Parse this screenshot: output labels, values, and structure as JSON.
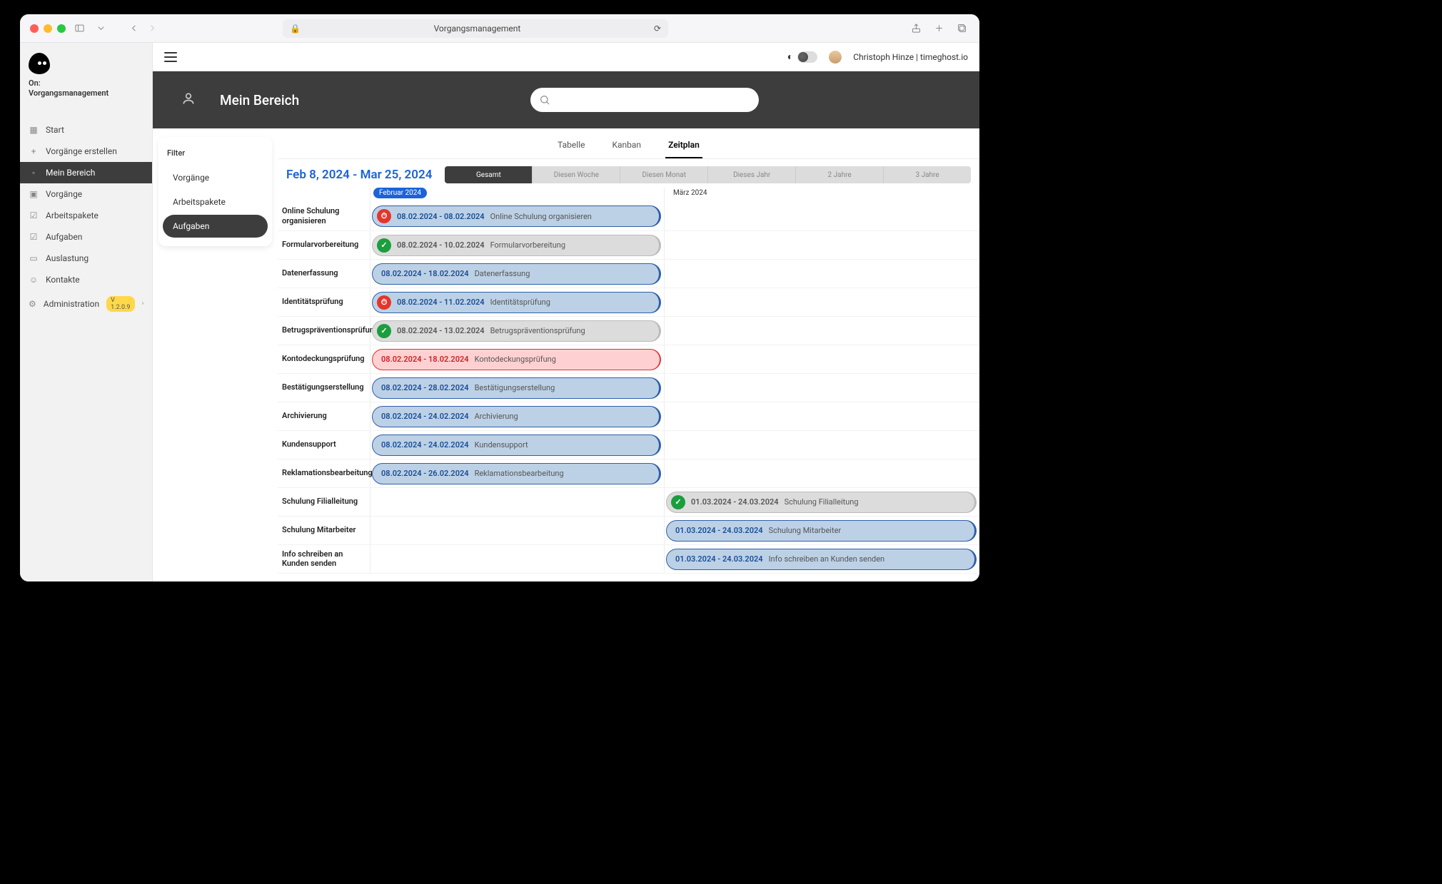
{
  "browser": {
    "title": "Vorgangsmanagement"
  },
  "sidebar": {
    "on_prefix": "On:",
    "on_title": "Vorgangsmanagement",
    "items": [
      {
        "label": "Start",
        "icon": "▦"
      },
      {
        "label": "Vorgänge erstellen",
        "icon": "+"
      },
      {
        "label": "Mein Bereich",
        "icon": "◦",
        "active": true
      },
      {
        "label": "Vorgänge",
        "icon": "▣"
      },
      {
        "label": "Arbeitspakete",
        "icon": "☑"
      },
      {
        "label": "Aufgaben",
        "icon": "☑"
      },
      {
        "label": "Auslastung",
        "icon": "▭"
      },
      {
        "label": "Kontakte",
        "icon": "☺"
      },
      {
        "label": "Administration",
        "icon": "⚙",
        "version": "V 1.2.0.9",
        "chevron": true
      }
    ]
  },
  "topbar": {
    "user": "Christoph Hinze | timeghost.io"
  },
  "band": {
    "title": "Mein Bereich",
    "search_placeholder": ""
  },
  "filter": {
    "title": "Filter",
    "items": [
      {
        "label": "Vorgänge"
      },
      {
        "label": "Arbeitspakete"
      },
      {
        "label": "Aufgaben",
        "active": true
      }
    ]
  },
  "view_tabs": [
    {
      "label": "Tabelle"
    },
    {
      "label": "Kanban"
    },
    {
      "label": "Zeitplan",
      "active": true
    }
  ],
  "range": {
    "title": "Feb 8, 2024 - Mar 25, 2024",
    "segments": [
      {
        "label": "Gesamt",
        "active": true
      },
      {
        "label": "Diesen Woche"
      },
      {
        "label": "Diesen Monat"
      },
      {
        "label": "Dieses Jahr"
      },
      {
        "label": "2 Jahre"
      },
      {
        "label": "3 Jahre"
      }
    ]
  },
  "months": {
    "feb": "Februar 2024",
    "mar": "März 2024"
  },
  "rows": [
    {
      "label": "Online Schulung organisieren",
      "col": "feb",
      "style": "blue",
      "status": "red",
      "dates": "08.02.2024 - 08.02.2024",
      "name": "Online Schulung organisieren"
    },
    {
      "label": "Formularvorbereitung",
      "col": "feb",
      "style": "grey",
      "status": "green",
      "dates": "08.02.2024 - 10.02.2024",
      "name": "Formularvorbereitung"
    },
    {
      "label": "Datenerfassung",
      "col": "feb",
      "style": "blue",
      "status": "none",
      "dates": "08.02.2024 - 18.02.2024",
      "name": "Datenerfassung"
    },
    {
      "label": "Identitätsprüfung",
      "col": "feb",
      "style": "blue",
      "status": "red",
      "dates": "08.02.2024 - 11.02.2024",
      "name": "Identitätsprüfung"
    },
    {
      "label": "Betrugspräventionsprüfung",
      "col": "feb",
      "style": "grey",
      "status": "green",
      "dates": "08.02.2024 - 13.02.2024",
      "name": "Betrugspräventionsprüfung"
    },
    {
      "label": "Kontodeckungsprüfung",
      "col": "feb",
      "style": "red",
      "status": "none",
      "dates": "08.02.2024 - 18.02.2024",
      "name": "Kontodeckungsprüfung"
    },
    {
      "label": "Bestätigungserstellung",
      "col": "feb",
      "style": "blue",
      "status": "none",
      "dates": "08.02.2024 - 28.02.2024",
      "name": "Bestätigungserstellung"
    },
    {
      "label": "Archivierung",
      "col": "feb",
      "style": "blue",
      "status": "none",
      "dates": "08.02.2024 - 24.02.2024",
      "name": "Archivierung"
    },
    {
      "label": "Kundensupport",
      "col": "feb",
      "style": "blue",
      "status": "none",
      "dates": "08.02.2024 - 24.02.2024",
      "name": "Kundensupport"
    },
    {
      "label": "Reklamationsbearbeitung",
      "col": "feb",
      "style": "blue",
      "status": "none",
      "dates": "08.02.2024 - 26.02.2024",
      "name": "Reklamationsbearbeitung"
    },
    {
      "label": "Schulung Filialleitung",
      "col": "mar",
      "style": "grey",
      "status": "green",
      "dates": "01.03.2024 - 24.03.2024",
      "name": "Schulung Filialleitung"
    },
    {
      "label": "Schulung Mitarbeiter",
      "col": "mar",
      "style": "blue",
      "status": "none",
      "dates": "01.03.2024 - 24.03.2024",
      "name": "Schulung Mitarbeiter"
    },
    {
      "label": "Info schreiben an Kunden senden",
      "col": "mar",
      "style": "blue",
      "status": "none",
      "dates": "01.03.2024 - 24.03.2024",
      "name": "Info schreiben an Kunden senden"
    }
  ]
}
